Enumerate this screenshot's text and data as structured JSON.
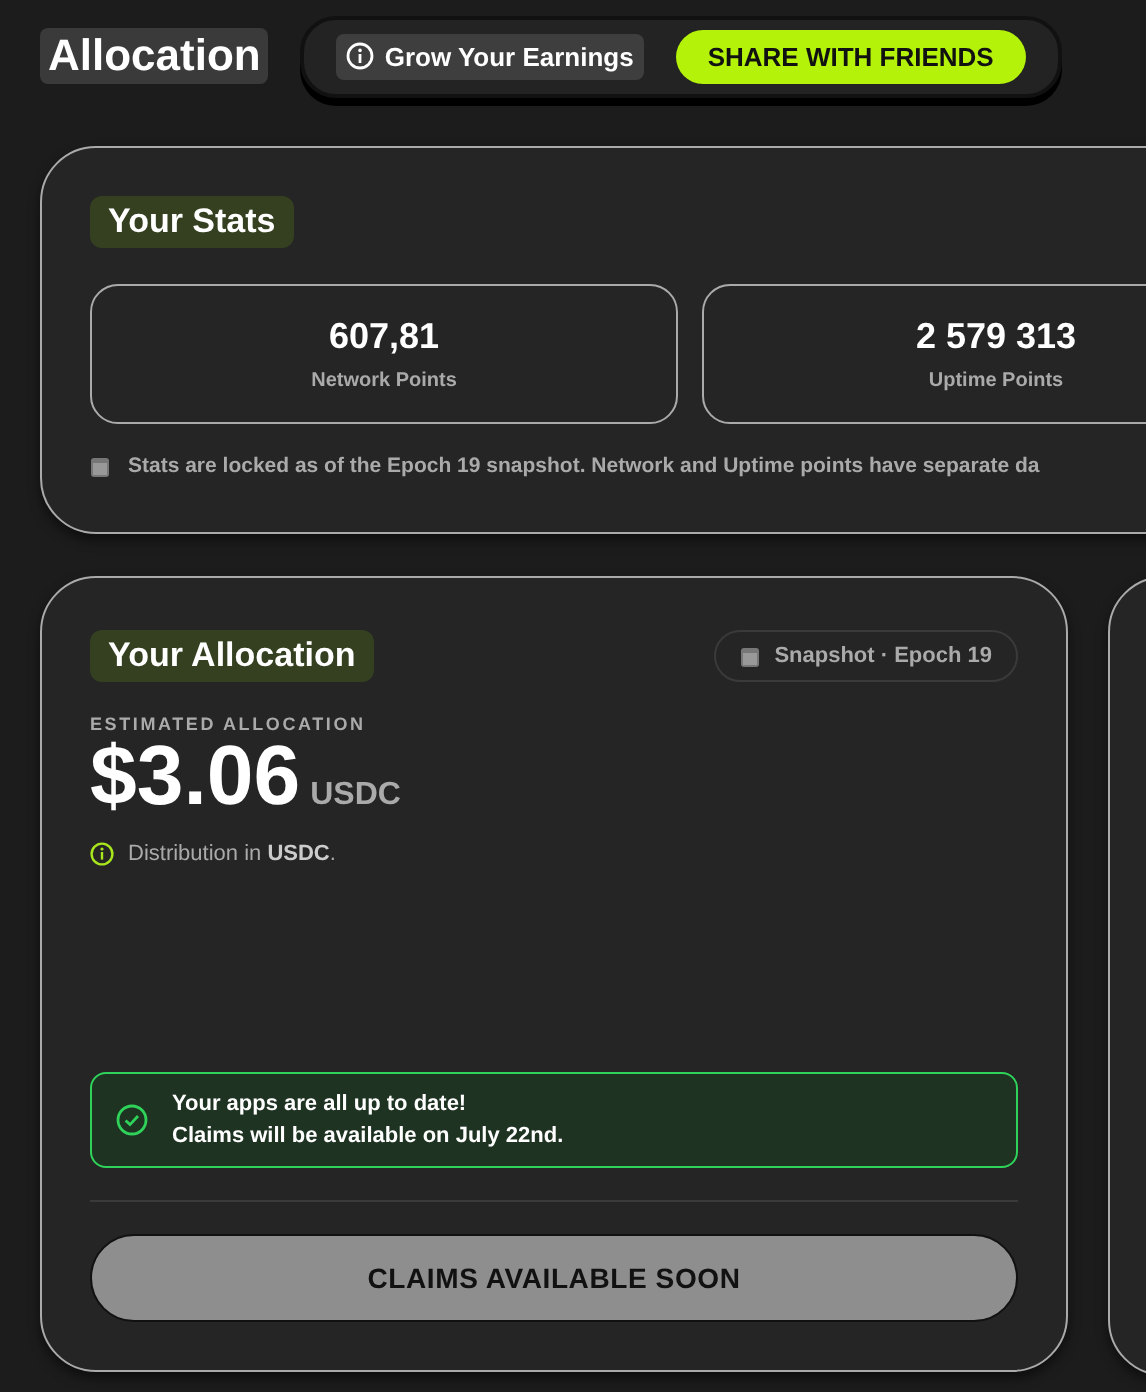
{
  "header": {
    "title": "Allocation",
    "promo": {
      "label": "Grow Your Earnings"
    },
    "share_button": {
      "label": "SHARE WITH FRIENDS"
    }
  },
  "stats": {
    "title": "Your Stats",
    "items": [
      {
        "value": "607,81",
        "label": "Network Points"
      },
      {
        "value": "2 579 313",
        "label": "Uptime Points"
      }
    ],
    "note": "Stats are locked as of the Epoch 19 snapshot. Network and Uptime points have separate da"
  },
  "allocation": {
    "title": "Your Allocation",
    "snapshot": "Snapshot · Epoch 19",
    "caption": "ESTIMATED ALLOCATION",
    "amount": "$3.06",
    "currency": "USDC",
    "distribution": "Distribution in **USDC**.",
    "status": {
      "kind": "success",
      "lines": [
        "Your apps are all up to date!",
        "Claims will be available on July 22nd."
      ]
    },
    "claim_button": {
      "label": "CLAIMS AVAILABLE SOON",
      "disabled": true
    }
  }
}
